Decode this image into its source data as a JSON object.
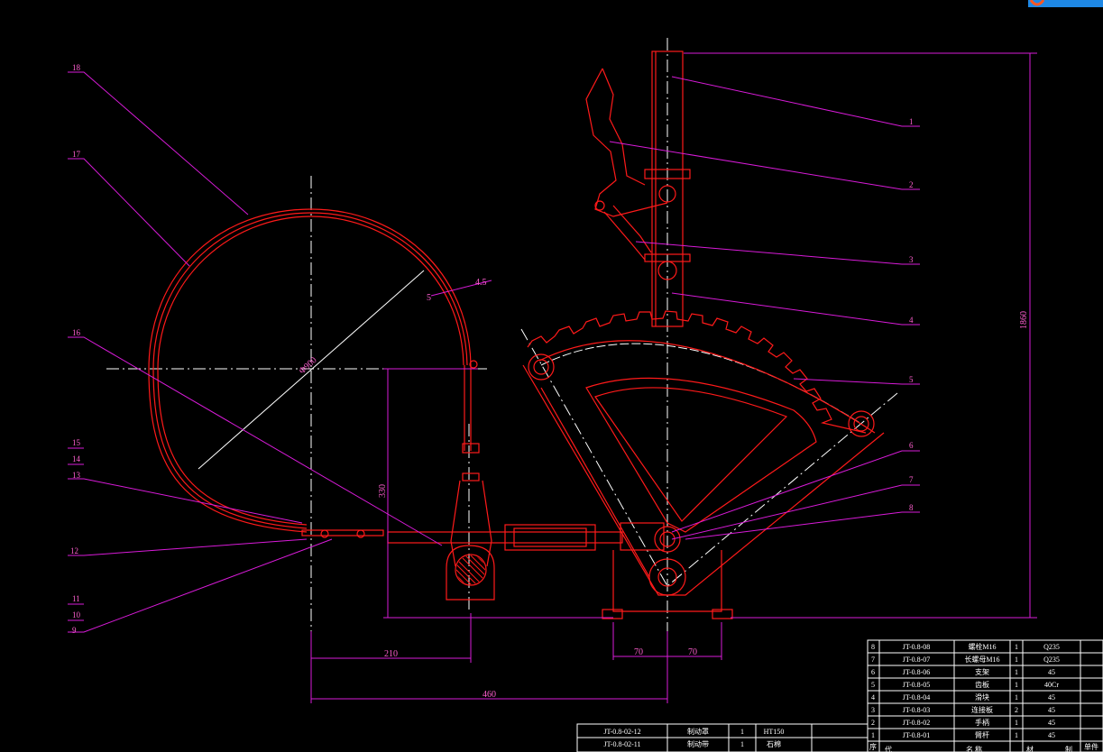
{
  "colors": {
    "background": "#000000",
    "part": "#ff1a1a",
    "centerline": "#ffffff",
    "leader": "#d81bd8",
    "text": "#ff5fd0",
    "table": "#ffffff"
  },
  "leader_labels": [
    "18",
    "17",
    "16",
    "15",
    "14",
    "13",
    "12",
    "11",
    "10",
    "9",
    "1",
    "2",
    "3",
    "4",
    "5",
    "6",
    "7",
    "8"
  ],
  "dimensions": {
    "d_big": "Φ900",
    "d_thk": "4.5",
    "d_thk_s": "5",
    "h_right": "1860",
    "h_mid": "330",
    "w_210": "210",
    "w_460": "460",
    "w_70a": "70",
    "w_70b": "70"
  },
  "parts_table": {
    "rows": [
      {
        "no": "8",
        "code": "JT-0.8-08",
        "name": "螺栓M16",
        "qty": "1",
        "mat": "Q235"
      },
      {
        "no": "7",
        "code": "JT-0.8-07",
        "name": "长螺母M16",
        "qty": "1",
        "mat": "Q235"
      },
      {
        "no": "6",
        "code": "JT-0.8-06",
        "name": "支架",
        "qty": "1",
        "mat": "45"
      },
      {
        "no": "5",
        "code": "JT-0.8-05",
        "name": "齿板",
        "qty": "1",
        "mat": "40Cr"
      },
      {
        "no": "4",
        "code": "JT-0.8-04",
        "name": "滑块",
        "qty": "1",
        "mat": "45"
      },
      {
        "no": "3",
        "code": "JT-0.8-03",
        "name": "连接板",
        "qty": "2",
        "mat": "45"
      },
      {
        "no": "2",
        "code": "JT-0.8-02",
        "name": "手柄",
        "qty": "1",
        "mat": "45"
      },
      {
        "no": "1",
        "code": "JT-0.8-01",
        "name": "臂杆",
        "qty": "1",
        "mat": "45"
      }
    ],
    "header": {
      "seq": "序",
      "code": "代",
      "name": "名 称",
      "mat": "材",
      "extra": "制",
      "side": "单件"
    },
    "left_rows": [
      {
        "code": "JT-0.8-02-12",
        "name": "制动罩",
        "qty": "1",
        "mat": "HT150"
      },
      {
        "code": "JT-0.8-02-11",
        "name": "制动带",
        "qty": "1",
        "mat": "石棉"
      }
    ]
  }
}
